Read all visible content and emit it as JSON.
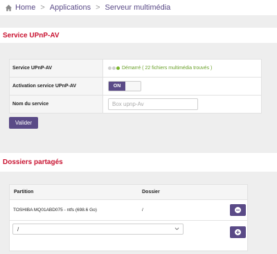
{
  "breadcrumb": {
    "items": [
      "Home",
      "Applications",
      "Serveur multimédia"
    ],
    "separator": ">"
  },
  "upnp": {
    "section_title": "Service UPnP-AV",
    "rows": [
      {
        "label": "Service UPnP-AV",
        "status_text": "Démarré ( 22 fichiers multimédia trouvés )"
      },
      {
        "label": "Activation service UPnP-AV",
        "toggle_label": "ON"
      },
      {
        "label": "Nom du service",
        "placeholder": "Box upnp-Av"
      }
    ],
    "submit_label": "Valider"
  },
  "shares": {
    "section_title": "Dossiers partagés",
    "columns": [
      "Partition",
      "Dossier"
    ],
    "rows": [
      {
        "partition": "TOSHIBA MQ01ABD075 - ntfs (698.6 Go)",
        "folder": "/"
      }
    ],
    "new_folder_value": "/"
  },
  "colors": {
    "accent": "#5a4a87",
    "title_red": "#c8102e",
    "status_green": "#6aa12a"
  },
  "icons": [
    "home-icon",
    "minus-circle-icon",
    "plus-circle-icon",
    "chevron-down-icon"
  ]
}
